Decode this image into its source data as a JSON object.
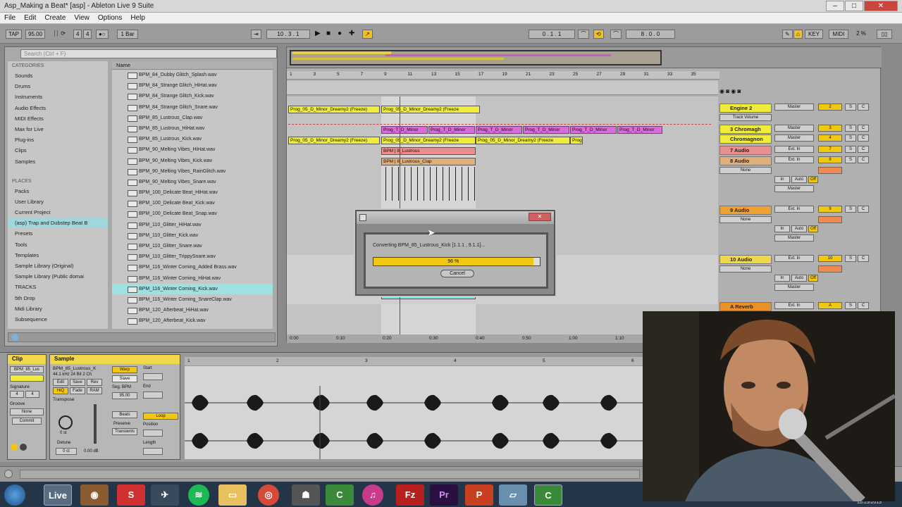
{
  "window": {
    "title": "Asp_Making a Beat* [asp] - Ableton Live 9 Suite",
    "min": "–",
    "max": "□",
    "close": "✕"
  },
  "menu": [
    "File",
    "Edit",
    "Create",
    "View",
    "Options",
    "Help"
  ],
  "transport": {
    "tap": "TAP",
    "tempo": "95.00",
    "sig_num": "4",
    "sig_den": "4",
    "bar": "1 Bar",
    "position": "10 . 3 . 1",
    "loop_start": "0 . 1 . 1",
    "loop_len": "8 . 0 . 0",
    "key": "KEY",
    "midi": "MIDI",
    "cpu": "2 %"
  },
  "browser": {
    "search_placeholder": "Search (Ctrl + F)",
    "categories_heading": "CATEGORIES",
    "categories": [
      "Sounds",
      "Drums",
      "Instruments",
      "Audio Effects",
      "MIDI Effects",
      "Max for Live",
      "Plug-ins",
      "Clips",
      "Samples"
    ],
    "places_heading": "PLACES",
    "places": [
      "Packs",
      "User Library",
      "Current Project",
      "(asp) Trap and Dubstep Beat B",
      "Presets",
      "Tools",
      "Templates",
      "Sample Library (Original)",
      "Sample Library (Public domai",
      "TRACKS",
      "5th Drop",
      "Midi Library",
      "Subsequence"
    ],
    "selected_place": "(asp) Trap and Dubstep Beat B",
    "name_header": "Name",
    "files": [
      "BPM_84_Dubby Glitch_Splash.wav",
      "BPM_84_Strange Glitch_HiHat.wav",
      "BPM_84_Strange Glitch_Kick.wav",
      "BPM_84_Strange Glitch_Snare.wav",
      "BPM_85_Lustrous_Clap.wav",
      "BPM_85_Lustrous_HiHat.wav",
      "BPM_85_Lustrous_Kick.wav",
      "BPM_90_Melting Vibes_HiHat.wav",
      "BPM_90_Melting Vibes_Kick.wav",
      "BPM_90_Melting Vibes_RainGlitch.wav",
      "BPM_90_Melting Vibes_Snare.wav",
      "BPM_100_Delicate Beat_HiHat.wav",
      "BPM_100_Delicate Beat_Kick.wav",
      "BPM_100_Delicate Beat_Snap.wav",
      "BPM_110_Glitter_HiHat.wav",
      "BPM_110_Glitter_Kick.wav",
      "BPM_110_Glitter_Snare.wav",
      "BPM_110_Glitter_TrippySnare.wav",
      "BPM_116_Winter Coming_Added Brass.wav",
      "BPM_116_Winter Coming_HiHat.wav",
      "BPM_116_Winter Coming_Kick.wav",
      "BPM_116_Winter Coming_SnareClap.wav",
      "BPM_120_Afterbeat_HiHat.wav",
      "BPM_120_Afterbeat_Kick.wav"
    ],
    "selected_file": "BPM_116_Winter Coming_Kick.wav"
  },
  "arrangement": {
    "ruler": [
      "1",
      "3",
      "5",
      "7",
      "9",
      "11",
      "13",
      "15",
      "17",
      "19",
      "21",
      "23",
      "25",
      "27",
      "29",
      "31",
      "33",
      "35"
    ],
    "time_ruler": [
      "0:00",
      "0:10",
      "0:20",
      "0:30",
      "0:40",
      "0:50",
      "1:00",
      "1:10",
      "1:20"
    ],
    "clips": {
      "prog_a": "Prog_05_D_Minor_Dreamy2 (Freeze)",
      "prog_b": "Prog_05_D_Minor_Dreamy2 (Freeze",
      "prog_short": "Prog",
      "pur": "Prog_T_D_Minor",
      "sal_label": "BPM",
      "sal_name": "8_Lustrous",
      "tan_name": "8_Lustrous_Clap"
    },
    "tracks": [
      {
        "name": "Engine 2",
        "num": "2",
        "color": "#f0ec3c"
      },
      {
        "name": "3 Chromagh",
        "num": "3",
        "color": "#f0ec3c"
      },
      {
        "name": "Chromagnon",
        "num": "4",
        "color": "#f0ec3c"
      },
      {
        "name": "7 Audio",
        "num": "7",
        "color": "#e89090"
      },
      {
        "name": "8 Audio",
        "num": "8",
        "color": "#e0b07a"
      },
      {
        "name": "9 Audio",
        "num": "9",
        "color": "#f0a030"
      },
      {
        "name": "10 Audio",
        "num": "10",
        "color": "#f0d84a"
      },
      {
        "name": "A Reverb",
        "num": "A",
        "color": "#e8902c"
      }
    ],
    "io": {
      "master": "Master",
      "track_volume": "Track Volume",
      "ext_in": "Ext. In",
      "none": "None",
      "in": "In",
      "auto": "Auto",
      "off": "Off",
      "s": "S",
      "c": "C"
    }
  },
  "dialog": {
    "message": "Converting BPM_85_Lustrous_Kick [1.1.1 , 9.1.1]...",
    "progress": 0.96,
    "progress_label": "96 %",
    "cancel": "Cancel"
  },
  "clip_view": {
    "clip_title": "Clip",
    "clip_name": "BPM_85_Lus",
    "signature_label": "Signature",
    "sig_num": "4",
    "sig_den": "4",
    "groove_label": "Groove",
    "groove_value": "None",
    "commit": "Commit",
    "sample_title": "Sample",
    "sample_name": "BPM_85_Lustrous_K",
    "sample_info": "44.1 kHz 24 Bit 2 Ch",
    "edit": "Edit",
    "save": "Save",
    "rev": "Rev",
    "hiq": "HiQ",
    "fade": "Fade",
    "ram": "RAM",
    "transpose_label": "Transpose",
    "transpose_value": "0 st",
    "detune_label": "Detune",
    "detune_value": "0 ct",
    "gain_value": "0.00 dB",
    "warp": "Warp",
    "seg_bpm_label": "Seg. BPM",
    "seg_bpm": "95.00",
    "mode": "Beats",
    "preserve_label": "Preserve",
    "preserve_value": "Transients",
    "start_label": "Start",
    "end_label": "End",
    "loop": "Loop",
    "position_label": "Position",
    "length_label": "Length",
    "ruler": [
      "1",
      "2",
      "3",
      "4",
      "5",
      "6"
    ]
  },
  "taskbar": {
    "live": "Live",
    "datetime": "12/15/2013"
  }
}
